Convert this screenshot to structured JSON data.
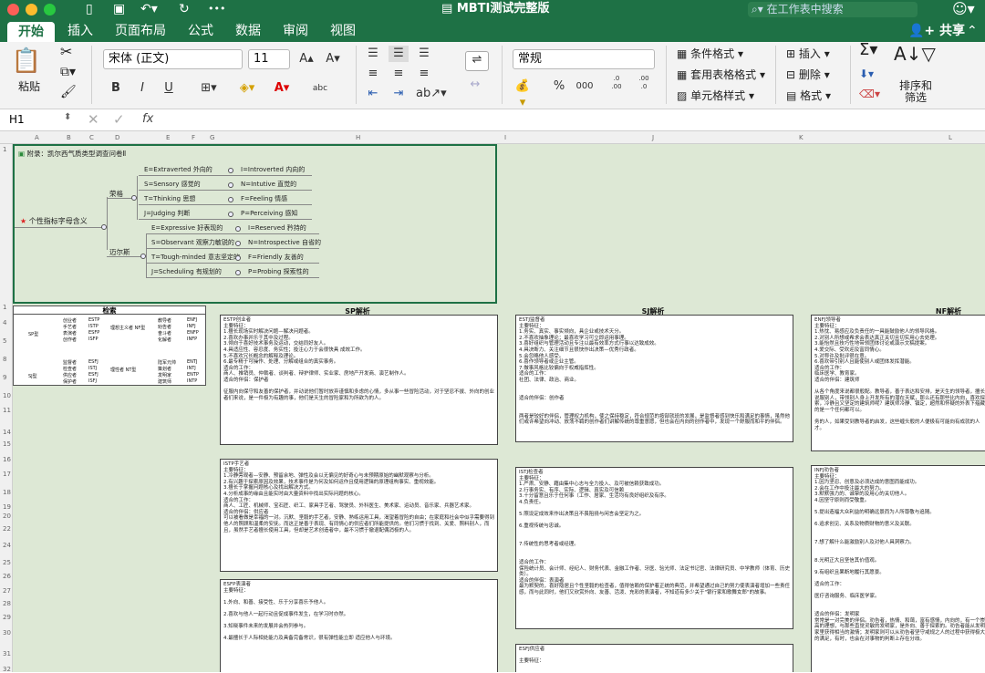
{
  "window": {
    "title": "MBTI测试完整版",
    "search_placeholder": "在工作表中搜索"
  },
  "tabs": [
    "开始",
    "插入",
    "页面布局",
    "公式",
    "数据",
    "审阅",
    "视图"
  ],
  "share_label": "共享",
  "ribbon": {
    "paste": "粘贴",
    "font_name": "宋体 (正文)",
    "font_size": "11",
    "bold": "B",
    "italic": "I",
    "underline": "U",
    "number_format": "常规",
    "percent": "%",
    "thousands": "000",
    "dec_inc": ".0 →.00",
    "dec_dec": ".00 →.0",
    "cond_format": "条件格式",
    "table_format": "套用表格格式",
    "cell_style": "单元格样式",
    "insert": "插入",
    "delete": "删除",
    "format": "格式",
    "sort_filter": "排序和\n筛选",
    "sigma": "Σ",
    "font_a_up": "A",
    "font_a_down": "A",
    "abc": "abc"
  },
  "formula_bar": {
    "cell_ref": "H1",
    "fx": "fx",
    "content": ""
  },
  "columns": [
    "A",
    "B",
    "C",
    "D",
    "E",
    "F",
    "G",
    "H",
    "I",
    "J",
    "K",
    "L"
  ],
  "rows": [
    "1",
    "",
    "",
    "",
    "",
    "",
    "",
    "",
    "",
    "",
    "",
    "",
    "",
    "",
    "",
    "",
    "",
    "",
    "",
    "",
    "",
    "",
    "",
    "",
    "",
    "",
    "",
    "",
    "",
    "",
    "",
    "",
    ""
  ],
  "diagram": {
    "header": "附录：凯尔西气质类型调查问卷Ⅱ",
    "root": "个性指标字母含义",
    "b1": "荣格",
    "b2": "迈尔斯",
    "items1": [
      "E=Extraverted 外向的",
      "I=Introverted 内向的",
      "S=Sensory 感觉的",
      "N=Intutive 直觉的",
      "T=Thinking 思想",
      "F=Feeling 情感",
      "J=Judging 判断",
      "P=Perceiving 感知"
    ],
    "items2": [
      "E=Expressive 好表现的",
      "I=Reserved 矜持的",
      "S=Observant 观察力敏锐的",
      "N=Introspective 自省的",
      "T=Tough-minded 意志坚定的",
      "F=Friendly 友善的",
      "J=Scheduling 有规划的",
      "P=Probing 探索性的"
    ]
  },
  "search_section": {
    "title": "检索",
    "left_top": [
      "艺术创造者",
      "SP型"
    ],
    "rows_top": [
      [
        "创业者",
        "ESTP"
      ],
      [
        "手艺者",
        "ISTP"
      ],
      [
        "表演者",
        "ESFP"
      ],
      [
        "创作者",
        "ISFP"
      ]
    ],
    "mid_top": "理想主义者 NF型",
    "right_top": [
      [
        "教导者",
        "ENFJ"
      ],
      [
        "劝告者",
        "INFJ"
      ],
      [
        "奋斗者",
        "ENFP"
      ],
      [
        "化解者",
        "INFP"
      ]
    ],
    "left_bot": [
      "护卫者",
      "SJ型"
    ],
    "rows_bot": [
      [
        "监督者",
        "ESFJ"
      ],
      [
        "检查者",
        "ISTJ"
      ],
      [
        "供应者",
        "ESFJ"
      ],
      [
        "保护者",
        "ISFJ"
      ]
    ],
    "mid_bot": "理性者 NT型",
    "right_bot": [
      [
        "陆军元帅",
        "ENTJ"
      ],
      [
        "策划者",
        "INTJ"
      ],
      [
        "发明家",
        "ENTP"
      ],
      [
        "建筑师",
        "INTP"
      ]
    ]
  },
  "sp_title": "SP解析",
  "sj_title": "SJ解析",
  "nf_title": "NF解析",
  "sp1": "ESTP创业者\n主要特征：\n1.擅长现场实时解决问题—解决问题者。\n2.喜欢办事并乐于其中及过程。\n3.倾向于喜好技术事务及运动，交结同好友人。\n4.具适应性、容忍度、务实性；投注心力于会很快具 成效工作。\n5.不喜欢冗长概念的解释及理论。\n6.最专精于可操作、处理、分解或组合的真实事务。\n适合的工作：\n商人、推销员、仲裁者、谈判者、辩护律师、实业家、房地产开发商、演艺制作人。\n适合的伴侣：保护者\n\n征服内向保守和友善的保护者，并动说他们暂时放弃谨慎和多虑的心情，多从事一些冒险活动，对于坚忍不拔、外向的创业者们来说，是一件极为有趣的事，他们是天生的冒险家和为所欲为的人。",
  "sp2": "ISTP手艺者\n主要特征：\n1.冷静旁观者—安静、预留余地、弹性及会以无偏见的好奇心与未预期原始的幽默观察与分析。\n2.有兴趣于探索原因及效果，技术事件是为何及如何运作且使用逻辑的原理组构事实、重视效能。\n3.擅长于掌握问题核心及找出解决方式。\n4.分析成事的缘由且能实时由大量资料中找出实际问题的核心。\n适合的工作：\n商人、工匠、机械师、宝石匠、织工、家具手艺者、驾驶员、外科医生、美术家、运动员、音乐家、兵器艺术家。\n适合的伴侣：供应者\n可以被看做是幸福的一对。沉默、坚毅的手艺者，安静、熟练运用工具，渴望着冒险的自由；在家庭和社会中似乎需要得到他人的照顾和温柔的安抚。而这正是善于表现、有同情心的供应者们所能提供的。他们习惯于找到、关爱、照料别人，而且，虽然手艺者擅长使用工具，但却是艺术创造者中，最不习惯于撤退配偶消极的人。",
  "sp3": "ESFP表演者\n主要特征：\n\n1.外向、和善、接受性、乐于分享喜乐予他人。\n\n2.喜欢与他人一起行动且促成事件发生，在学习时亦然。\n\n3.知晓事件未来的发展并会热列参与。\n\n4.最擅长于人际相处能力及具备完备常识，很有弹性能立即 适应他人与环境。",
  "sj1": "ESTJ监督者\n主要特征：\n1.务实、真实、事实倾向，具企业或技术天分。\n2.不喜欢抽象理论；最喜欢学习可立即运用事理。\n3.喜好组织与管理活动且专注以最有效率方式行事以达致成效。\n4.具决断力、关注细节且很快作出决策—优秀行政者。\n5.会忽略他人感受。\n6.喜作领导者或企业主管。\n7.做事风格比较偏向于权威指挥性。\n适合的工作：\n社团、法律、政治、商业。\n\n\n适合的伴侣：创作者\n\n\n两者是较好的伴侣，管理权力机构，使之保持稳定，符合规范的按部就班的发展，是监督者感到快乐和满足的事情，虽然他们或许希望向冲动、放荡不羁的创作者们讲解传统的尊重意愿，但也会在内向的创作者中，发现一个舒服而和平的伴侣。",
  "sj2": "ISTJ检查者\n主要特征：\n1.严肃、安静、藉由集中心志与全力投入、及可被信赖获致成功。\n2.行事务实、有序、实际、逻辑、真实及可信赖\n3.十分留意且乐于任何事（工作、居家、生活均有良好组织及有序。\n4.负责任。\n\n5.照设定成效来作出决策且不畏阻挠与闲言会坚定为之。\n\n6.重视传统与忠诚。\n\n\n7.传统性的思考者或经理。\n\n\n适合的工作：\n保险统计员、会计师、经纪人、财务代表、金融工作者、牙医、验光师、法定书记官、法律研究员、中学教师（体育、历史类）。\n适合的伴侣：表演者\n最为默契的，喜好隐居且个性坚毅的检查者，值得信赖的保护着正统的典范，并希望通过自己的努力使表演者增加一些责任感，而与此同时，他们又欣赏外向、友善、活泼、充彩的表演者，不知道有多少关于\"银行家和歌舞女郎\"的故事。",
  "sj3": "ESFJ供应者\n\n主要特征：",
  "nf1": "ENFJ领导者\n主要特征：\n1.热忱、易感应及负责任的一具能鼓励他人的领导风格。\n2.对别人所想或希求会表达真正关切且切实用心去处理。\n3.能怡然且技巧性地带领团体讨论或演示文稿提案。\n4.爱交际、受欢迎及富同情心。\n5.对称许及批评很在意。\n6.喜欢带引别人且能使别人或团体发挥潜能。\n适合的工作：\n临床医学、教育家。\n适合的伴侣：建筑师\n\n从各个角度来说都很般配。教导者，善于表达和安排，是天生的领导者，擅长说服别人，带领别人身上开发所有的潜在天赋，那么还有那些比内向，喜欢探索，冷静且又坚定的建筑师呢？建筑师冷静、镇定，超然和怀疑的外表下蕴藏的是一个任何都可以。\n\n务的人，如果受到教导者的启发，这些缠头般的人便极有可能向有成就的人才。",
  "nf2": "INFJ劝告者\n主要特征：\n1.因为坚忍、创意及必须达成的意图而能成功。\n2.会在工作中投注最大的努力。\n3.默默强力的、诚挚的及用心的关切他人。\n4.因坚守原则而受敬重。\n\n5.提出造福大众利益的明确远景而为人所尊敬与追随。\n\n6.追求创见、关系及物质财物的意义及关联。\n\n\n7.想了解什么能激励别人及对他人具洞察力。\n\n\n8.光明正大且坚信其价值观。\n\n9.有组织且果断地履行其愿景。\n\n适合的工作：\n\n医疗咨询服务、临床医学家。\n\n\n适合的伴侣：发明家\n常常是一对完美的伴侣。劝告者，热情、和蔼，富有感情，内向的，有一个崇高的理想，与那些直觉灵敏的发明家，是外向、善于探索的。劝告者能从发明家里获得相当的激情；发明家则可以从劝告者坚守戒规之人的过程中获得极大的满足，有时，也会在对事物的判断上存在分歧。"
}
